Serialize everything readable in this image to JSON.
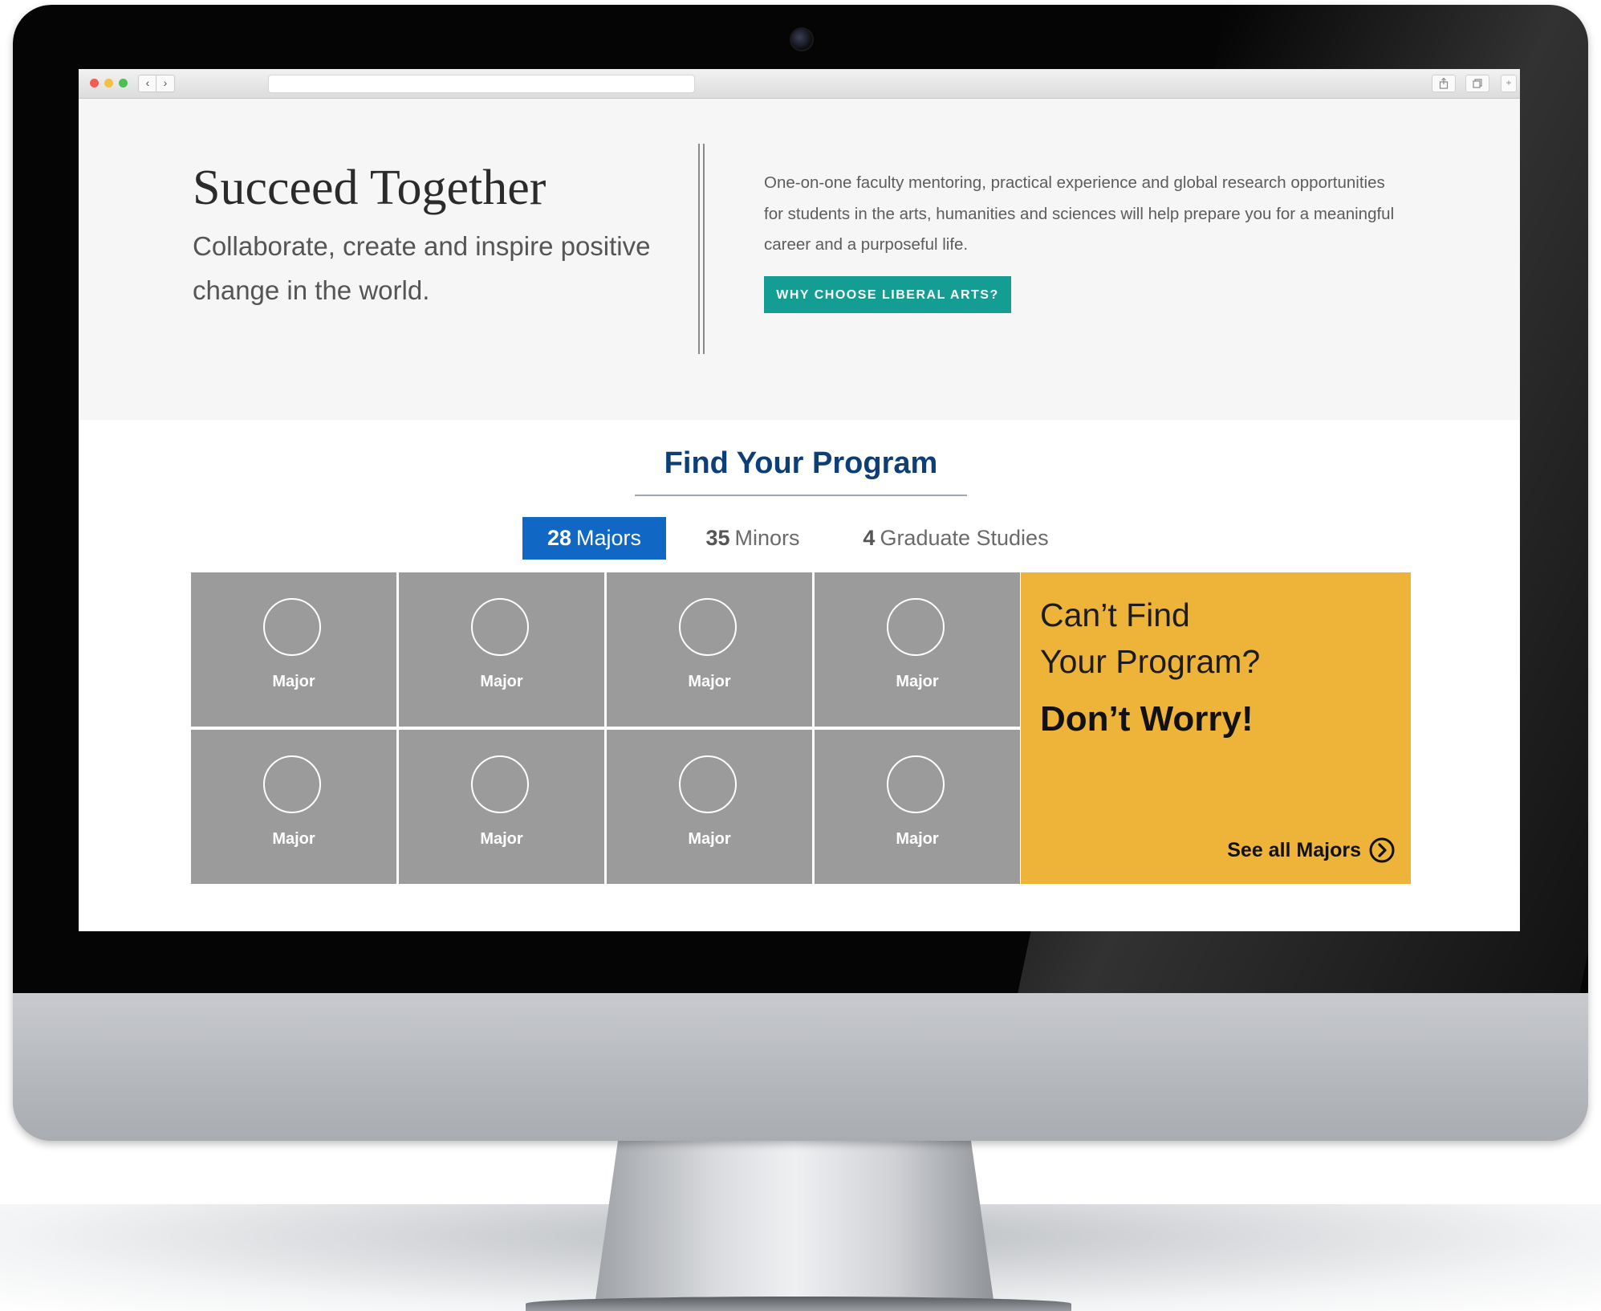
{
  "hero": {
    "title": "Succeed Together",
    "subtitle": "Collaborate, create and inspire positive change in the world.",
    "description": "One-on-one faculty mentoring, practical experience and global research opportunities for students in the arts, humanities and sciences will help prepare you for a meaningful career and a purposeful life.",
    "button_label": "WHY CHOOSE LIBERAL ARTS?"
  },
  "programs": {
    "heading": "Find Your Program",
    "tabs": [
      {
        "count": "28",
        "label": "Majors",
        "active": true
      },
      {
        "count": "35",
        "label": "Minors",
        "active": false
      },
      {
        "count": "4",
        "label": "Graduate Studies",
        "active": false
      }
    ],
    "tiles": [
      {
        "label": "Major"
      },
      {
        "label": "Major"
      },
      {
        "label": "Major"
      },
      {
        "label": "Major"
      },
      {
        "label": "Major"
      },
      {
        "label": "Major"
      },
      {
        "label": "Major"
      },
      {
        "label": "Major"
      }
    ],
    "promo": {
      "line1": "Can’t Find",
      "line2": "Your Program?",
      "strong": "Don’t Worry!",
      "link_label": "See all Majors"
    }
  },
  "browser": {
    "back_icon": "chevron-left-icon",
    "forward_icon": "chevron-right-icon"
  },
  "colors": {
    "accent_teal": "#139d93",
    "tab_blue": "#1168c4",
    "heading_navy": "#0c3f78",
    "tile_gray": "#9b9b9b",
    "promo_yellow": "#eeb43a"
  }
}
